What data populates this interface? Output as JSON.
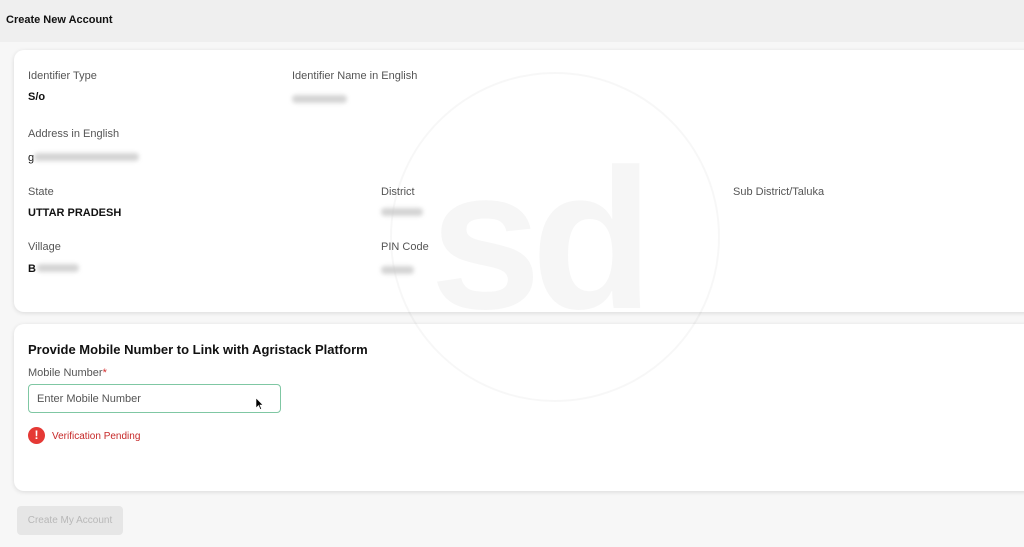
{
  "header": {
    "title": "Create New Account"
  },
  "details": {
    "identifier_type": {
      "label": "Identifier Type",
      "value": "S/o"
    },
    "identifier_name": {
      "label": "Identifier Name in English"
    },
    "address": {
      "label": "Address in English",
      "value_prefix": "g"
    },
    "state": {
      "label": "State",
      "value": "UTTAR PRADESH"
    },
    "district": {
      "label": "District"
    },
    "sub_district": {
      "label": "Sub District/Taluka"
    },
    "village": {
      "label": "Village",
      "value_prefix": "B"
    },
    "pin_code": {
      "label": "PIN Code"
    }
  },
  "mobile_section": {
    "title": "Provide Mobile Number to Link with Agristack Platform",
    "field_label": "Mobile Number",
    "required_mark": "*",
    "placeholder": "Enter Mobile Number",
    "status_text": "Verification Pending",
    "status_icon": "exclamation-icon",
    "status_color": "#e53935"
  },
  "actions": {
    "create_label": "Create My Account"
  },
  "watermark": {
    "text": "sd"
  }
}
